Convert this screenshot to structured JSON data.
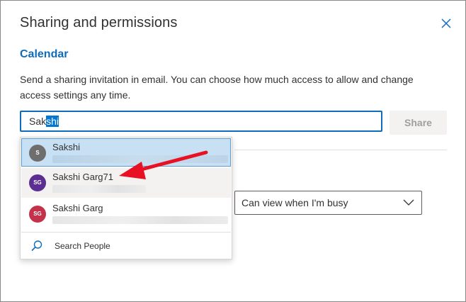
{
  "dialog": {
    "title": "Sharing and permissions",
    "close_icon": "close-icon"
  },
  "calendar": {
    "heading": "Calendar",
    "description": "Send a sharing invitation in email. You can choose how much access to allow and change access settings any time."
  },
  "search": {
    "typed_text": "Sak",
    "selected_text": "shi",
    "full_value": "Sakshi"
  },
  "share_button": {
    "label": "Share",
    "disabled": true
  },
  "permission_select": {
    "value": "Can view when I'm busy",
    "icon": "chevron-down-icon"
  },
  "suggestions": [
    {
      "name": "Sakshi",
      "initials": "S",
      "avatar_color": "#6e6e6e",
      "state": "selected"
    },
    {
      "name": "Sakshi Garg71",
      "initials": "SG",
      "avatar_color": "#5c2e91",
      "state": "hover"
    },
    {
      "name": "Sakshi Garg",
      "initials": "SG",
      "avatar_color": "#c4314b",
      "state": "normal"
    }
  ],
  "search_people": {
    "label": "Search People",
    "icon": "search-icon"
  },
  "colors": {
    "accent": "#0f6cbd",
    "selected_text_bg": "#0078d4",
    "annotation_arrow": "#e81123"
  }
}
